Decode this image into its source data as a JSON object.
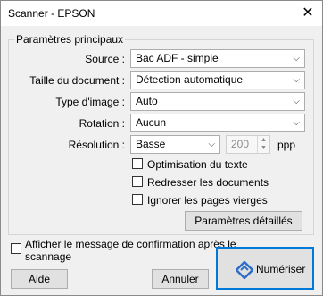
{
  "window": {
    "title": "Scanner - EPSON"
  },
  "group": {
    "title": "Paramètres principaux"
  },
  "fields": {
    "source": {
      "label": "Source :",
      "value": "Bac ADF - simple"
    },
    "document_size": {
      "label": "Taille du document :",
      "value": "Détection automatique"
    },
    "image_type": {
      "label": "Type d'image :",
      "value": "Auto"
    },
    "rotation": {
      "label": "Rotation :",
      "value": "Aucun"
    },
    "resolution": {
      "label": "Résolution :",
      "value": "Basse",
      "numeric": "200",
      "unit": "ppp"
    }
  },
  "options": {
    "text_optimization": {
      "label": "Optimisation du texte",
      "checked": false
    },
    "straighten": {
      "label": "Redresser les documents",
      "checked": false
    },
    "ignore_blank": {
      "label": "Ignorer les pages vierges",
      "checked": false
    }
  },
  "buttons": {
    "advanced": "Paramètres détaillés",
    "help": "Aide",
    "cancel": "Annuler",
    "scan": "Numériser"
  },
  "confirm": {
    "label_line1": "Afficher le message de confirmation après le",
    "label_line2": "scannage",
    "checked": false
  },
  "colors": {
    "accent": "#0078d7",
    "scan_icon": "#2f6fc6"
  },
  "icons": {
    "scan": "scan-diamond-icon",
    "close": "close-icon",
    "chevron": "chevron-down-icon"
  }
}
